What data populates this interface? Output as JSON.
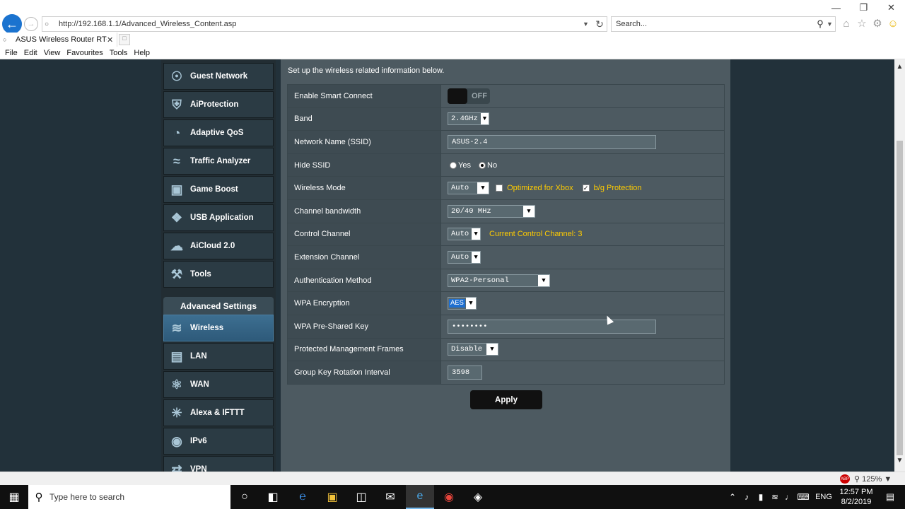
{
  "browser": {
    "url": "http://192.168.1.1/Advanced_Wireless_Content.asp",
    "search_placeholder": "Search...",
    "tab_title": "ASUS Wireless Router RT-A...",
    "menu": [
      "File",
      "Edit",
      "View",
      "Favourites",
      "Tools",
      "Help"
    ],
    "zoom": "125%"
  },
  "sidebar": {
    "items_top": [
      {
        "label": "Guest Network",
        "icon": "globe-network-icon"
      },
      {
        "label": "AiProtection",
        "icon": "shield-lock-icon"
      },
      {
        "label": "Adaptive QoS",
        "icon": "gauge-icon"
      },
      {
        "label": "Traffic Analyzer",
        "icon": "waveform-icon"
      },
      {
        "label": "Game Boost",
        "icon": "gamepad-icon"
      },
      {
        "label": "USB Application",
        "icon": "puzzle-icon"
      },
      {
        "label": "AiCloud 2.0",
        "icon": "cloud-icon"
      },
      {
        "label": "Tools",
        "icon": "wrench-icon"
      }
    ],
    "advanced_header": "Advanced Settings",
    "items_advanced": [
      {
        "label": "Wireless",
        "icon": "wifi-icon"
      },
      {
        "label": "LAN",
        "icon": "monitor-icon"
      },
      {
        "label": "WAN",
        "icon": "globe-icon"
      },
      {
        "label": "Alexa & IFTTT",
        "icon": "nodes-icon"
      },
      {
        "label": "IPv6",
        "icon": "ipv6-icon"
      },
      {
        "label": "VPN",
        "icon": "vpn-icon"
      }
    ]
  },
  "content": {
    "intro": "Set up the wireless related information below.",
    "labels": {
      "smart_connect": "Enable Smart Connect",
      "band": "Band",
      "ssid": "Network Name (SSID)",
      "hide_ssid": "Hide SSID",
      "wireless_mode": "Wireless Mode",
      "channel_bandwidth": "Channel bandwidth",
      "control_channel": "Control Channel",
      "extension_channel": "Extension Channel",
      "auth_method": "Authentication Method",
      "wpa_encryption": "WPA Encryption",
      "wpa_psk": "WPA Pre-Shared Key",
      "pmf": "Protected Management Frames",
      "gkri": "Group Key Rotation Interval"
    },
    "values": {
      "smart_connect_state": "OFF",
      "band": "2.4GHz",
      "ssid": "ASUS-2.4",
      "hide_yes": "Yes",
      "hide_no": "No",
      "wireless_mode": "Auto",
      "xbox_label": "Optimized for Xbox",
      "bg_label": "b/g Protection",
      "channel_bandwidth": "20/40 MHz",
      "control_channel": "Auto",
      "current_channel": "Current Control Channel: 3",
      "extension_channel": "Auto",
      "auth_method": "WPA2-Personal",
      "wpa_encryption": "AES",
      "wpa_psk": "••••••••",
      "pmf": "Disable",
      "gkri": "3598"
    },
    "apply_label": "Apply"
  },
  "taskbar": {
    "search_placeholder": "Type here to search",
    "lang": "ENG",
    "time": "12:57 PM",
    "date": "8/2/2019"
  }
}
